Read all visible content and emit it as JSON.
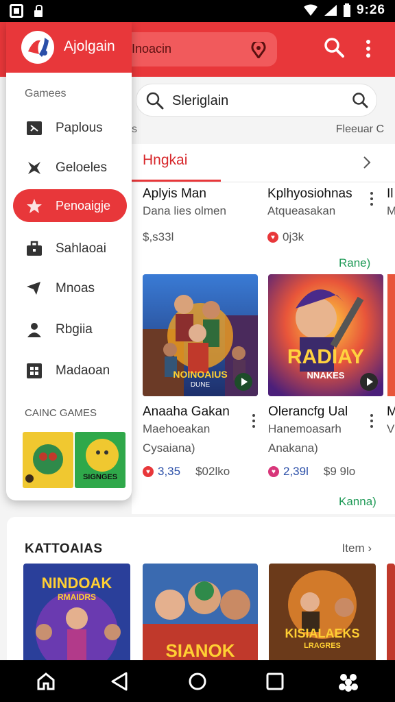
{
  "status_bar": {
    "time": "9:26"
  },
  "app_bar": {
    "search_text": "Inoacin"
  },
  "drawer": {
    "title": "Ajolgain",
    "section1": "Gamees",
    "items": [
      {
        "label": "Paplous",
        "icon": "game-icon"
      },
      {
        "label": "Geloeles",
        "icon": "star-outline-icon"
      },
      {
        "label": "Penoaigje",
        "icon": "star-icon",
        "active": true
      },
      {
        "label": "Sahlaoai",
        "icon": "briefcase-icon"
      },
      {
        "label": "Mnoas",
        "icon": "tag-icon"
      },
      {
        "label": "Rbgiia",
        "icon": "people-icon"
      },
      {
        "label": "Madaoan",
        "icon": "grid-icon"
      }
    ],
    "section2": "CAINC GAMES",
    "thumb2_text": "SIGNGES"
  },
  "search": {
    "value": "Sleriglain"
  },
  "sub_row": {
    "left": "s",
    "right": "Fleeuar C"
  },
  "tabs": {
    "active": "Hngkai"
  },
  "top_cards": [
    {
      "title": "Aplyis Man",
      "subtitle": "Dana lies olmen",
      "price": "$,s33l"
    },
    {
      "title": "Kplhyosiohnas",
      "subtitle": "Atqueasakan",
      "rating": "0j3k",
      "link": "Rane)"
    },
    {
      "title": "Il",
      "subtitle": "M"
    }
  ],
  "game_cards": [
    {
      "title": "Anaaha Gakan",
      "subtitle": "Maehoeakan",
      "extra": "Cysaiana)",
      "rating": "3,35",
      "price": "$02lko",
      "thumb_text": "NOINOAIUS",
      "thumb_subtext": "DUNE"
    },
    {
      "title": "Olerancfg Ual",
      "subtitle": "Hanemoasarh",
      "extra": "Anakana)",
      "rating": "2,39l",
      "price": "$9 9lo",
      "link": "Kanna)",
      "thumb_text": "RADIAY",
      "thumb_subtext": "NNAKES"
    },
    {
      "title": "M",
      "subtitle": "V"
    }
  ],
  "section2": {
    "title": "KATTOAIAS",
    "more": "Item",
    "thumbs": [
      {
        "text": "NINDOAK",
        "subtext": "RMAIDRS"
      },
      {
        "text": "SIANOK"
      },
      {
        "text": "KISIALAEKS",
        "subtext": "LRAGRES"
      }
    ]
  },
  "colors": {
    "primary": "#e8373a",
    "green_link": "#1f9a57"
  }
}
